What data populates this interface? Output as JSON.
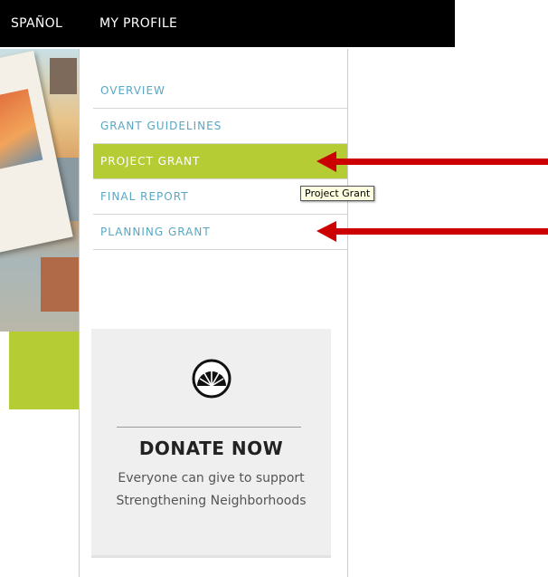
{
  "topbar": {
    "language_label": "SPAÑOL",
    "profile_label": "MY PROFILE"
  },
  "nav": {
    "items": [
      {
        "label": "OVERVIEW"
      },
      {
        "label": "GRANT GUIDELINES"
      },
      {
        "label": "PROJECT GRANT",
        "active": true
      },
      {
        "label": "FINAL REPORT"
      },
      {
        "label": "PLANNING GRANT"
      }
    ]
  },
  "tooltip": {
    "text": "Project Grant"
  },
  "donate": {
    "title": "DONATE NOW",
    "text": "Everyone can give to support Strengthening Neighborhoods"
  },
  "colors": {
    "accent_green": "#b5cc35",
    "link_blue": "#5aa7c3",
    "arrow_red": "#cc0000"
  },
  "icons": [
    "sunburst-logo-icon",
    "annotation-arrow-icon"
  ]
}
